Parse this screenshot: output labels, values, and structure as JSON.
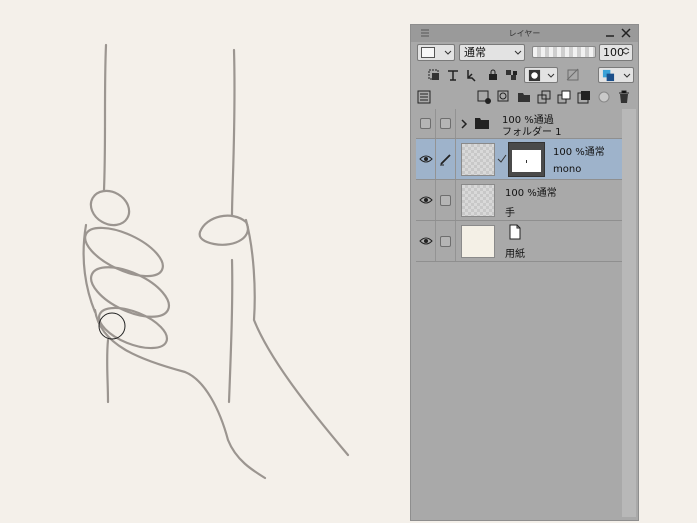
{
  "panel": {
    "title": "レイヤー",
    "blend_mode": "通常",
    "opacity": "100",
    "colors": {
      "panel_bg": "#a9a9a9",
      "selected_row": "#9eb3cb",
      "canvas_bg": "#f4f0ea"
    }
  },
  "toolbar_icons": [
    "clip-icon",
    "reference-icon",
    "draft-icon",
    "lock-icon",
    "lock-transparent-icon",
    "mask-icon",
    "mask-hide-icon",
    "layer-color-icon"
  ],
  "action_icons": [
    "layer-property-icon",
    "new-raster-icon",
    "new-vector-icon",
    "new-folder-icon",
    "transfer-down-icon",
    "merge-down-icon",
    "mask-create-icon",
    "mask-apply-icon",
    "camera-icon",
    "delete-icon"
  ],
  "layers": [
    {
      "blend": "100 %通過",
      "name": "フォルダー 1",
      "type": "folder"
    },
    {
      "blend": "100 %通常",
      "name": "mono",
      "type": "raster-with-mask",
      "selected": true
    },
    {
      "blend": "100 %通常",
      "name": "手",
      "type": "raster"
    },
    {
      "blend": "",
      "name": "用紙",
      "type": "paper"
    }
  ]
}
